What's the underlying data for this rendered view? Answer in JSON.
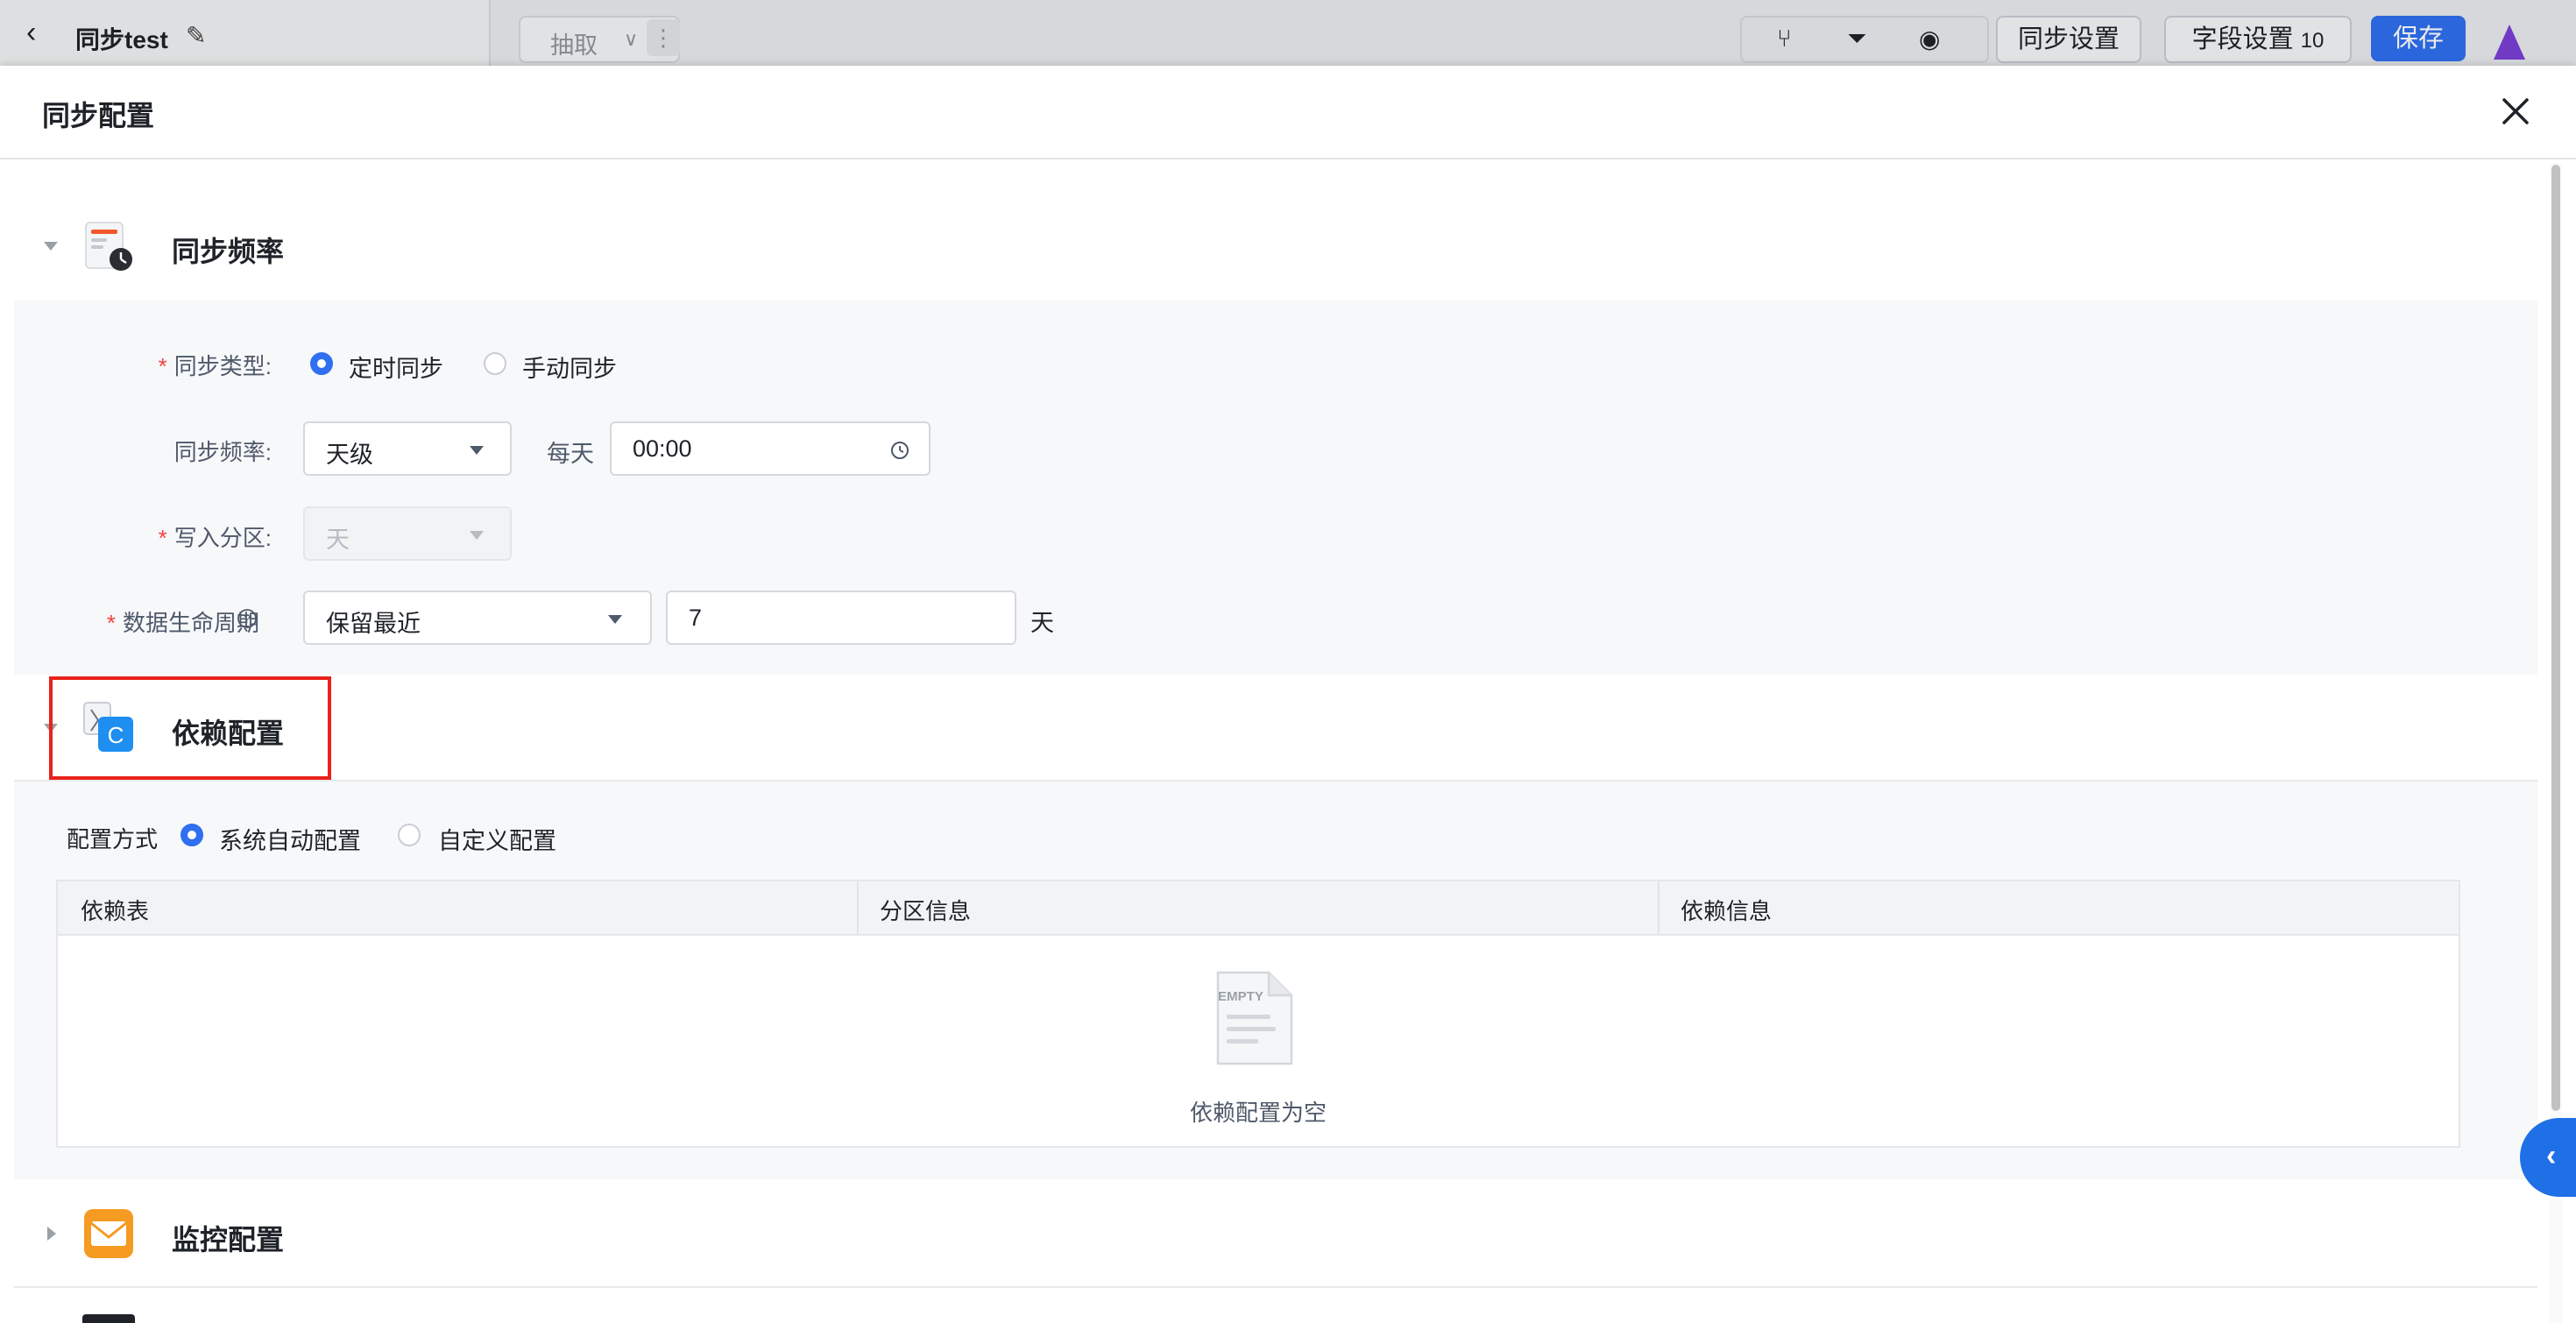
{
  "background_app": {
    "title": "同步test",
    "extract_label": "抽取",
    "sync_settings": "同步设置",
    "field_settings": "字段设置",
    "field_count": "10",
    "save": "保存"
  },
  "drawer": {
    "title": "同步配置"
  },
  "sync_frequency": {
    "section_title": "同步频率",
    "sync_type_label": "同步类型:",
    "sync_type_options": [
      "定时同步",
      "手动同步"
    ],
    "sync_type_selected": "定时同步",
    "frequency_label": "同步频率:",
    "frequency_value": "天级",
    "daily_label": "每天",
    "time_value": "00:00",
    "partition_label": "写入分区:",
    "partition_value": "天",
    "lifecycle_label": "数据生命周期",
    "lifecycle_mode": "保留最近",
    "lifecycle_days": "7",
    "lifecycle_unit": "天"
  },
  "dependency": {
    "section_title": "依赖配置",
    "mode_label": "配置方式",
    "mode_options": [
      "系统自动配置",
      "自定义配置"
    ],
    "mode_selected": "系统自动配置",
    "table_columns": [
      "依赖表",
      "分区信息",
      "依赖信息"
    ],
    "table_rows": [],
    "empty_doc_text": "EMPTY",
    "empty_text": "依赖配置为空"
  },
  "monitor": {
    "section_title": "监控配置"
  },
  "colors": {
    "primary": "#2f6ff0",
    "required": "#f53f3f",
    "highlight": "#e8221b"
  }
}
